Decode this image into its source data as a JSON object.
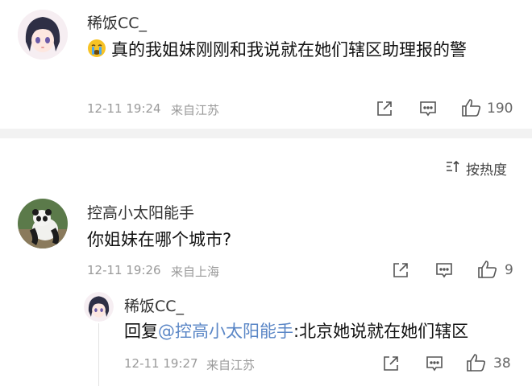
{
  "comment1": {
    "username": "稀饭CC_",
    "emoji_icon": "crying-face-icon",
    "text": "真的我姐妹刚刚和我说就在她们辖区助理报的警",
    "time": "12-11 19:24",
    "location": "来自江苏",
    "likes": "190"
  },
  "sort_label": "按热度",
  "comment2": {
    "username": "控高小太阳能手",
    "text": "你姐妹在哪个城市?",
    "time": "12-11 19:26",
    "location": "来自上海",
    "likes": "9"
  },
  "reply": {
    "username": "稀饭CC_",
    "prefix": "回复",
    "mention": "@控高小太阳能手",
    "text": ":北京她说就在她们辖区",
    "time": "12-11 19:27",
    "location": "来自江苏",
    "likes": "38"
  },
  "colors": {
    "mention": "#5a86c6",
    "meta": "#9a9a9a",
    "divider": "#f2f2f2"
  }
}
